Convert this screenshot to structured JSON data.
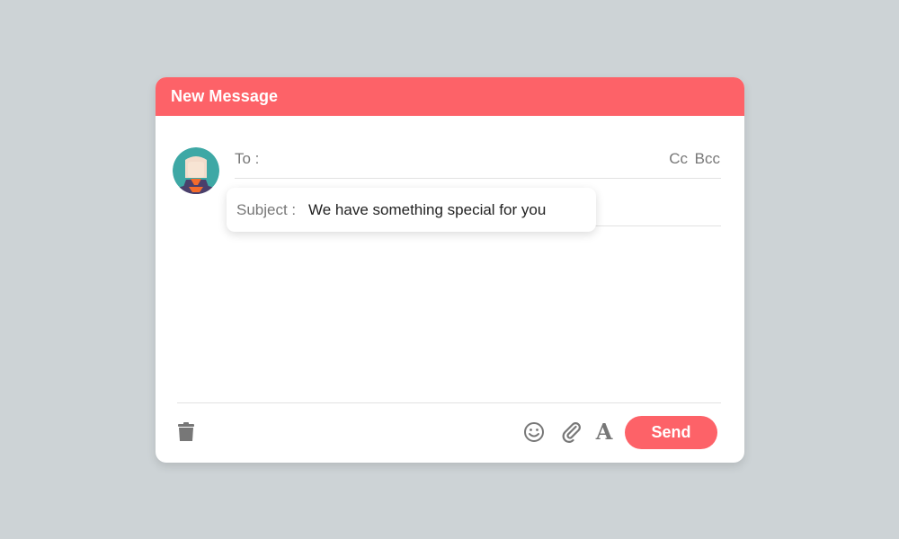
{
  "compose": {
    "title": "New Message",
    "to_label": "To :",
    "cc_label": "Cc",
    "bcc_label": "Bcc",
    "subject_label": "Subject :",
    "subject_value": "We have something special for you",
    "send_label": "Send",
    "format_glyph": "A"
  },
  "colors": {
    "accent": "#fd6268",
    "background": "#cdd3d6",
    "muted_text": "#777777"
  },
  "icons": [
    "avatar",
    "trash-icon",
    "emoji-icon",
    "attachment-icon",
    "text-format-icon"
  ]
}
